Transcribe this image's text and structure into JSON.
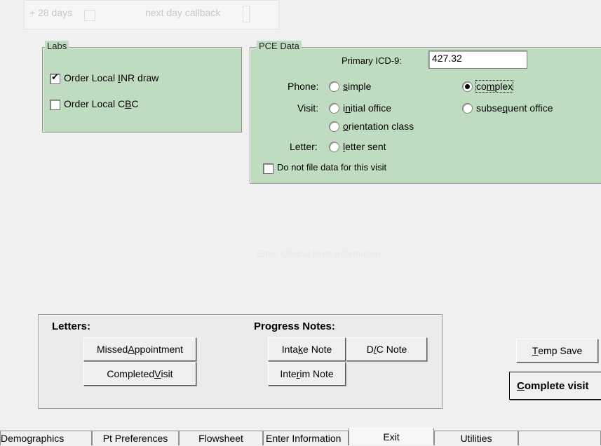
{
  "top_fragment": {
    "days_label": "+ 28 days",
    "callback_label": "next day callback"
  },
  "labs": {
    "title": "Labs",
    "items": [
      {
        "label": "Order Local INR draw",
        "checked": true
      },
      {
        "label": "Order Local CBC",
        "checked": false
      }
    ]
  },
  "pce": {
    "title": "PCE Data",
    "icd_label": "Primary ICD-9:",
    "icd_value": "427.32",
    "phone_label": "Phone:",
    "phone_options": [
      {
        "label": "simple",
        "selected": false
      },
      {
        "label": "complex",
        "selected": true
      }
    ],
    "visit_label": "Visit:",
    "visit_options": [
      {
        "label": "initial office",
        "selected": false
      },
      {
        "label": "subsequent office",
        "selected": false
      },
      {
        "label": "orientation class",
        "selected": false
      }
    ],
    "letter_label": "Letter:",
    "letter_options": [
      {
        "label": "letter sent",
        "selected": false
      }
    ],
    "no_file_label": "Do not file data for this visit",
    "no_file_checked": false
  },
  "ghost_overlay_text": "Enter Clinical Note Information",
  "letters": {
    "title": "Letters:",
    "missed_appointment": "Missed Appointment",
    "completed_visit": "Completed Visit"
  },
  "progress_notes": {
    "title": "Progress Notes:",
    "intake_note": "Intake Note",
    "dc_note": "D/C Note",
    "interim_note": "Interim Note"
  },
  "actions": {
    "temp_save": "Temp Save",
    "complete_visit": "Complete visit"
  },
  "tabs": [
    {
      "label": "Demographics",
      "active": false
    },
    {
      "label": "Pt Preferences",
      "active": false
    },
    {
      "label": "Flowsheet",
      "active": false
    },
    {
      "label": "Enter Information",
      "active": false
    },
    {
      "label": "Exit",
      "active": true
    },
    {
      "label": "Utilities",
      "active": false
    },
    {
      "label": "",
      "active": false
    }
  ]
}
